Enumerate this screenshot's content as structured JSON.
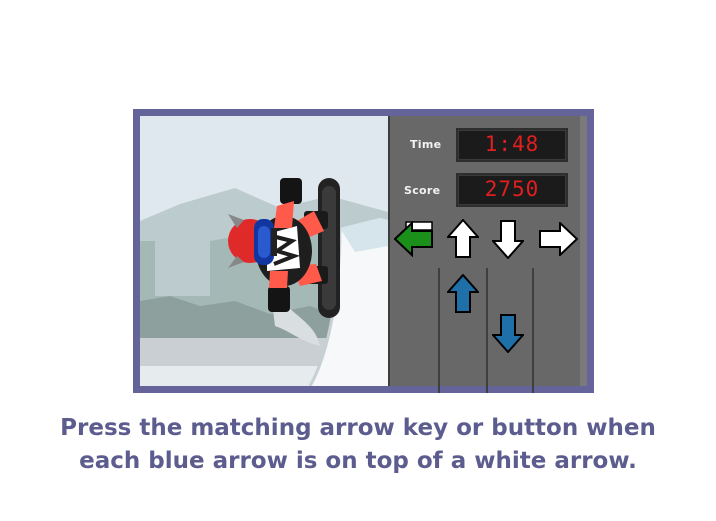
{
  "hud": {
    "time_label": "Time",
    "time_value": "1:48",
    "score_label": "Score",
    "score_value": "2750"
  },
  "target_arrows": [
    {
      "direction": "left",
      "state": "highlighted",
      "color": "#1a8f1a"
    },
    {
      "direction": "up",
      "state": "idle",
      "color": "#ffffff"
    },
    {
      "direction": "down",
      "state": "idle",
      "color": "#ffffff"
    },
    {
      "direction": "right",
      "state": "idle",
      "color": "#ffffff"
    }
  ],
  "falling_arrows": [
    {
      "direction": "up",
      "color": "#1f6fa8"
    },
    {
      "direction": "down",
      "color": "#1f6fa8"
    }
  ],
  "instructions": {
    "line1": "Press the matching arrow key or button when",
    "line2": "each blue arrow is on top of a white arrow."
  },
  "colors": {
    "frame": "#64649a",
    "led_text": "#e21f1f",
    "instruction_text": "#5c5c8e"
  }
}
